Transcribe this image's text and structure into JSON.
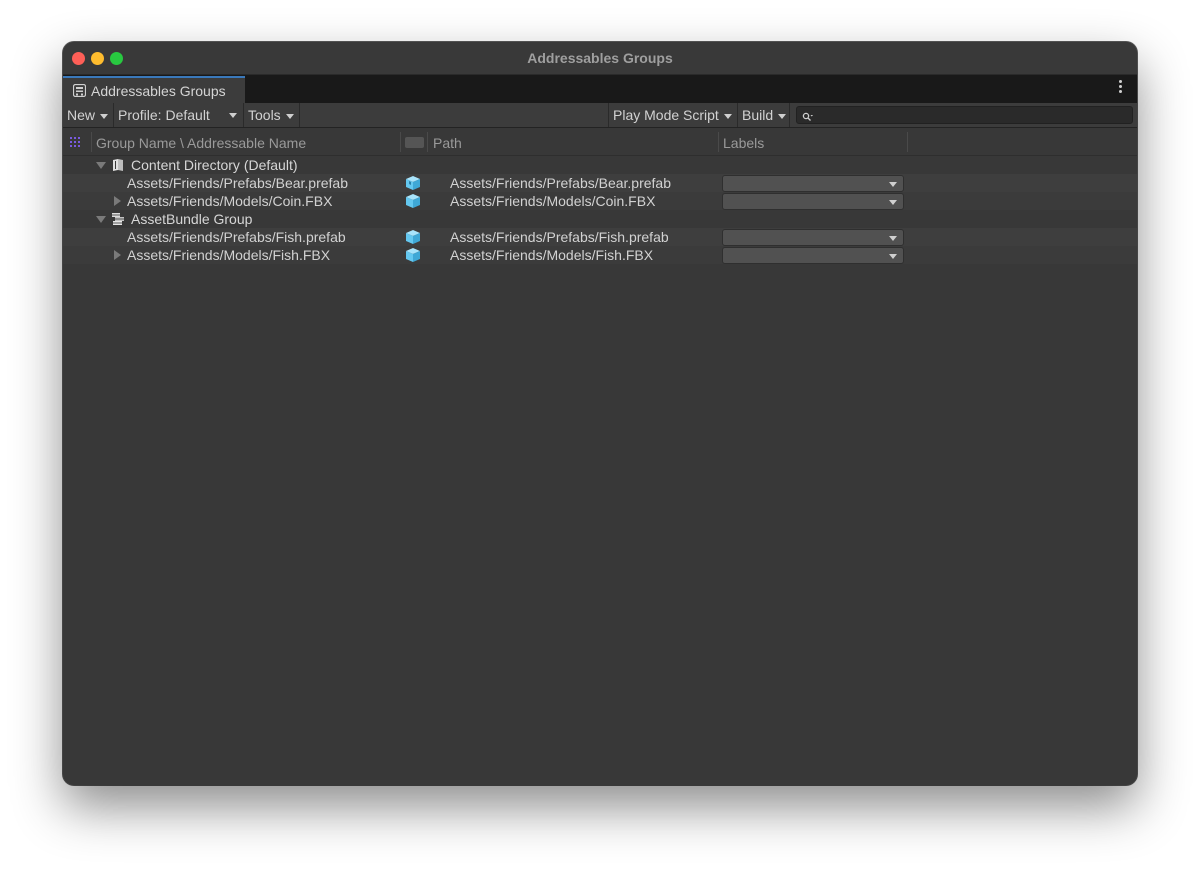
{
  "window": {
    "title": "Addressables Groups"
  },
  "tab": {
    "label": "Addressables Groups",
    "icon": "addressables-window-icon"
  },
  "toolbar": {
    "new_label": "New",
    "profile_label": "Profile: Default",
    "tools_label": "Tools",
    "play_mode_label": "Play Mode Script",
    "build_label": "Build",
    "search": {
      "value": "",
      "placeholder": ""
    }
  },
  "columns": {
    "name": "Group Name \\ Addressable Name",
    "path": "Path",
    "labels": "Labels"
  },
  "groups": [
    {
      "name": "Content Directory (Default)",
      "icon": "content-directory-icon",
      "entries": [
        {
          "name": "Assets/Friends/Prefabs/Bear.prefab",
          "path": "Assets/Friends/Prefabs/Bear.prefab",
          "icon": "prefab-cube-icon",
          "expandable": false,
          "label": ""
        },
        {
          "name": "Assets/Friends/Models/Coin.FBX",
          "path": "Assets/Friends/Models/Coin.FBX",
          "icon": "model-cube-icon",
          "expandable": true,
          "label": ""
        }
      ]
    },
    {
      "name": "AssetBundle Group",
      "icon": "assetbundle-group-icon",
      "entries": [
        {
          "name": "Assets/Friends/Prefabs/Fish.prefab",
          "path": "Assets/Friends/Prefabs/Fish.prefab",
          "icon": "prefab-cube-icon",
          "expandable": false,
          "label": ""
        },
        {
          "name": "Assets/Friends/Models/Fish.FBX",
          "path": "Assets/Friends/Models/Fish.FBX",
          "icon": "model-cube-icon",
          "expandable": true,
          "label": ""
        }
      ]
    }
  ],
  "colors": {
    "window_bg": "#383838",
    "accent_tab": "#3a79bb",
    "cube_icon": "#64c8f0",
    "grid_icon": "#7a5be0"
  }
}
